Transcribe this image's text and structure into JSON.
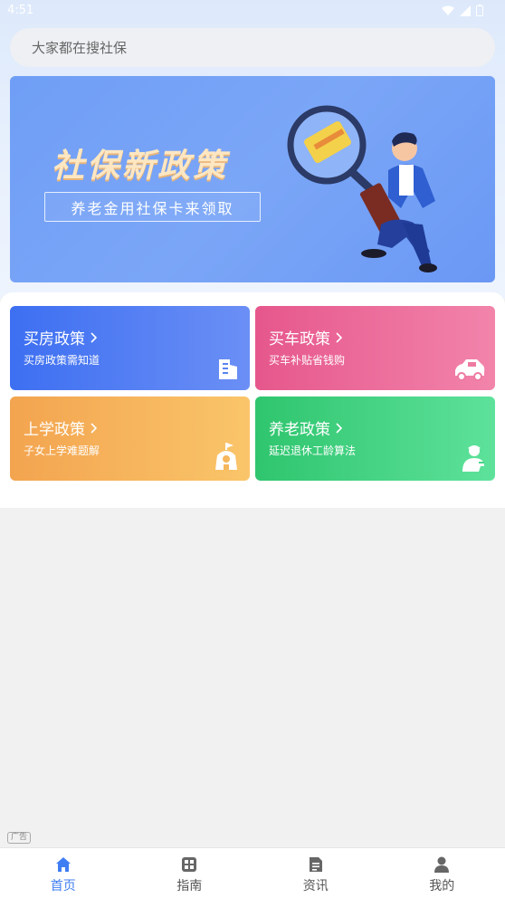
{
  "status_bar": {
    "time": "4:51"
  },
  "search": {
    "placeholder": "大家都在搜社保"
  },
  "banner": {
    "title": "社保新政策",
    "subtitle": "养老金用社保卡来领取"
  },
  "cards": [
    {
      "title": "买房政策",
      "desc": "买房政策需知道",
      "icon": "building-icon",
      "color_from": "#3d6ff2",
      "color_to": "#6b8ff5"
    },
    {
      "title": "买车政策",
      "desc": "买车补贴省钱购",
      "icon": "car-icon",
      "color_from": "#e6578c",
      "color_to": "#f284aa"
    },
    {
      "title": "上学政策",
      "desc": "子女上学难题解",
      "icon": "school-icon",
      "color_from": "#f3a44f",
      "color_to": "#fac56a"
    },
    {
      "title": "养老政策",
      "desc": "延迟退休工龄算法",
      "icon": "elderly-icon",
      "color_from": "#2fc56e",
      "color_to": "#5ee29b"
    }
  ],
  "ad_tag": "广告",
  "tabbar": {
    "active_color": "#3f7ef2",
    "items": [
      {
        "label": "首页",
        "icon": "home-icon",
        "active": true
      },
      {
        "label": "指南",
        "icon": "grid-icon",
        "active": false
      },
      {
        "label": "资讯",
        "icon": "document-icon",
        "active": false
      },
      {
        "label": "我的",
        "icon": "user-icon",
        "active": false
      }
    ]
  }
}
